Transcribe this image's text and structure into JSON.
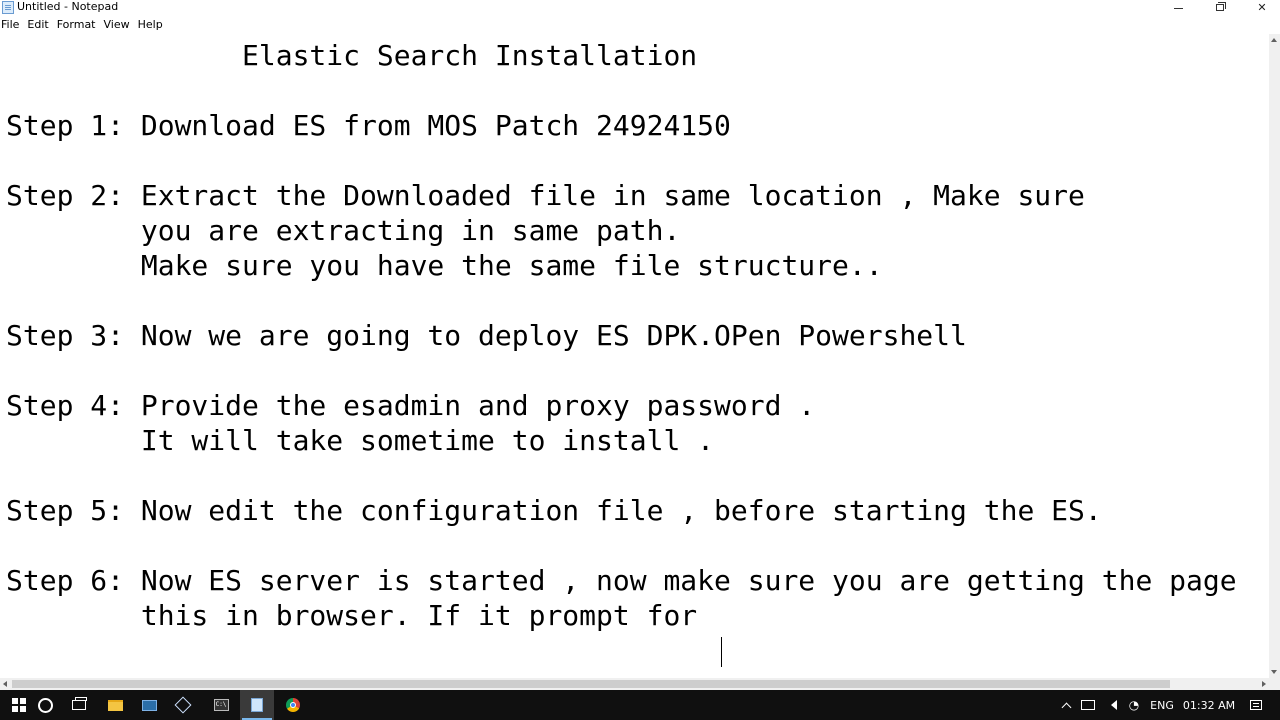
{
  "window": {
    "title": "Untitled - Notepad"
  },
  "menu": {
    "items": [
      "File",
      "Edit",
      "Format",
      "View",
      "Help"
    ]
  },
  "document": {
    "text": "              Elastic Search Installation\n\nStep 1: Download ES from MOS Patch 24924150\n\nStep 2: Extract the Downloaded file in same location , Make sure\n        you are extracting in same path.\n        Make sure you have the same file structure..\n\nStep 3: Now we are going to deploy ES DPK.OPen Powershell\n\nStep 4: Provide the esadmin and proxy password .\n        It will take sometime to install .\n\nStep 5: Now edit the configuration file , before starting the ES.\n\nStep 6: Now ES server is started , now make sure you are getting the page\n        this in browser. If it prompt for "
  },
  "taskbar": {
    "cmd_label": "C:\\",
    "language": "ENG",
    "time": "01:32 AM",
    "icons": [
      "windows-start-icon",
      "cortana-search-icon",
      "task-view-icon",
      "file-explorer-icon",
      "remote-desktop-icon",
      "virtualbox-icon",
      "command-prompt-icon",
      "notepad-icon",
      "chrome-icon"
    ]
  },
  "colors": {
    "taskbar_bg": "#101010",
    "active_accent": "#7ab8ec",
    "scrollbar_bg": "#f0f0f0",
    "scrollbar_thumb": "#cdcdcd"
  }
}
